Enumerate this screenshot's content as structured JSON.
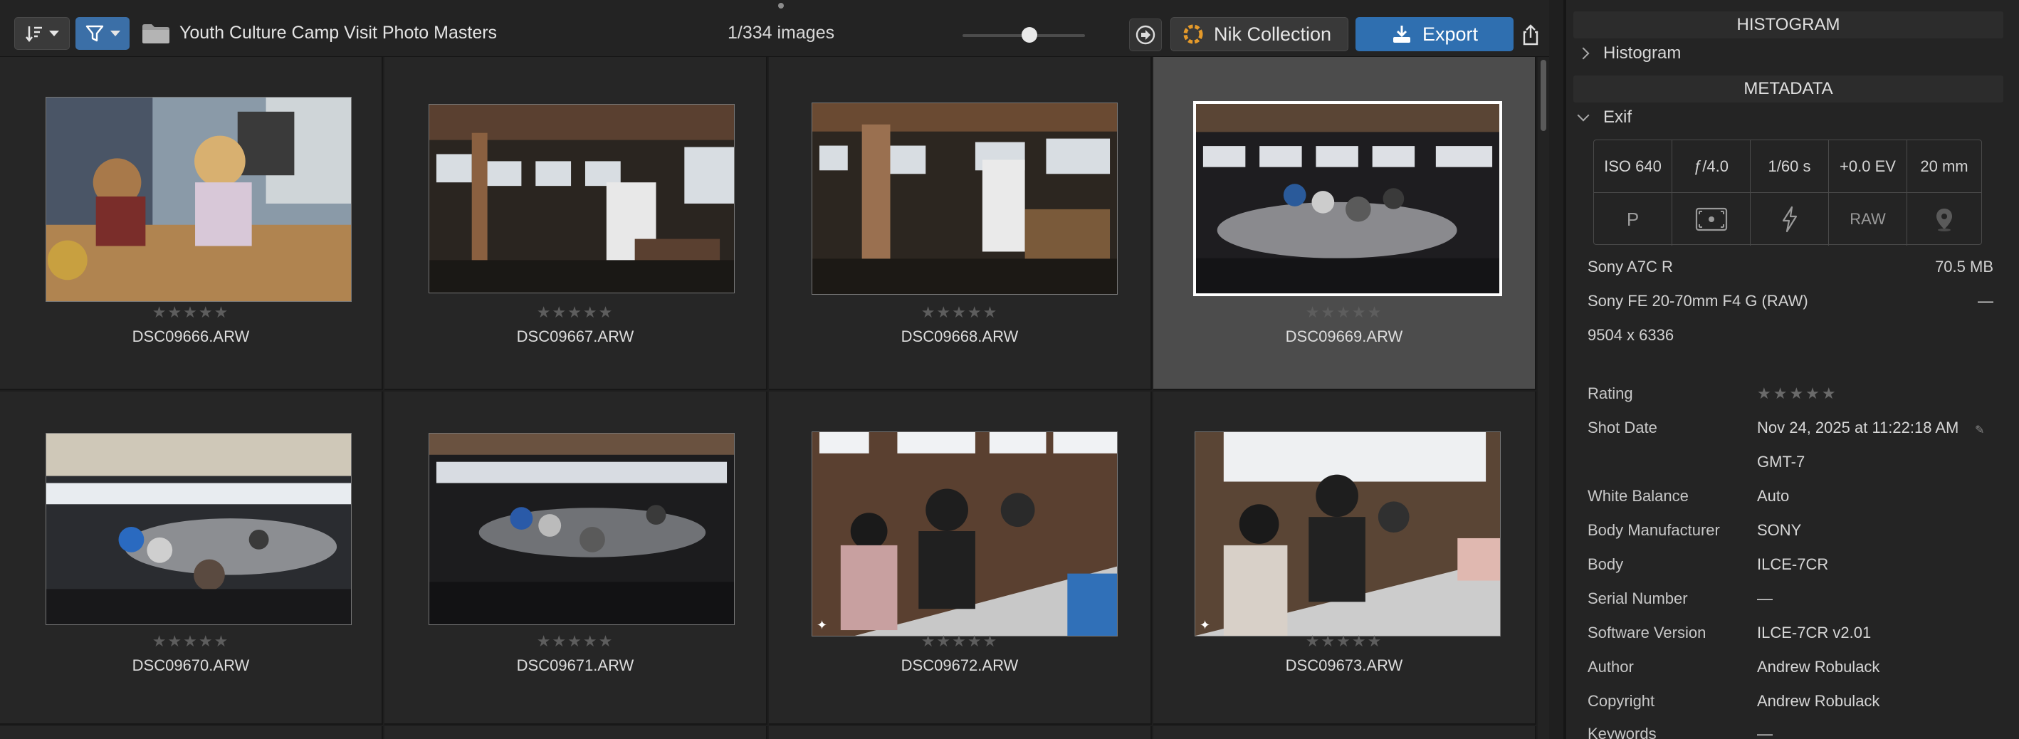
{
  "toolbar": {
    "folder_name": "Youth Culture Camp Visit Photo Masters",
    "image_count": "1/334 images",
    "nik_label": "Nik Collection",
    "export_label": "Export",
    "zoom_level": 0.55,
    "icons": [
      "sort-icon",
      "filter-icon",
      "folder-icon",
      "goto-icon",
      "nik-logo-icon",
      "export-icon",
      "share-icon"
    ]
  },
  "thumbnails": [
    {
      "filename": "DSC09666.ARW",
      "stars": "★★★★★",
      "rating": 0,
      "selected": false,
      "edited": false
    },
    {
      "filename": "DSC09667.ARW",
      "stars": "★★★★★",
      "rating": 0,
      "selected": false,
      "edited": false
    },
    {
      "filename": "DSC09668.ARW",
      "stars": "★★★★★",
      "rating": 0,
      "selected": false,
      "edited": false
    },
    {
      "filename": "DSC09669.ARW",
      "stars": "★★★★★",
      "rating": 0,
      "selected": true,
      "edited": false
    },
    {
      "filename": "DSC09670.ARW",
      "stars": "★★★★★",
      "rating": 0,
      "selected": false,
      "edited": false
    },
    {
      "filename": "DSC09671.ARW",
      "stars": "★★★★★",
      "rating": 0,
      "selected": false,
      "edited": false
    },
    {
      "filename": "DSC09672.ARW",
      "stars": "★★★★★",
      "rating": 0,
      "selected": false,
      "edited": true
    },
    {
      "filename": "DSC09673.ARW",
      "stars": "★★★★★",
      "rating": 0,
      "selected": false,
      "edited": true
    }
  ],
  "inspector": {
    "histogram_title": "HISTOGRAM",
    "histogram_section": "Histogram",
    "metadata_title": "METADATA",
    "exif_section": "Exif",
    "exif": {
      "iso": "ISO 640",
      "aperture": "ƒ/4.0",
      "shutter": "1/60 s",
      "ev": "+0.0 EV",
      "focal": "20 mm",
      "mode": "P",
      "raw": "RAW",
      "icons": [
        "metering-icon",
        "flash-icon",
        "location-icon"
      ]
    },
    "camera": "Sony A7C R",
    "file_size": "70.5 MB",
    "lens": "Sony FE 20-70mm F4 G (RAW)",
    "lens_extra": "—",
    "dimensions": "9504 x 6336",
    "fields": [
      {
        "key": "Rating",
        "value": "★★★★★"
      },
      {
        "key": "Shot Date",
        "value": "Nov 24, 2025 at 11:22:18 AM"
      },
      {
        "key": "",
        "value": "GMT-7"
      },
      {
        "key": "White Balance",
        "value": "Auto"
      },
      {
        "key": "Body Manufacturer",
        "value": "SONY"
      },
      {
        "key": "Body",
        "value": "ILCE-7CR"
      },
      {
        "key": "Serial Number",
        "value": "—"
      },
      {
        "key": "Software Version",
        "value": "ILCE-7CR v2.01"
      },
      {
        "key": "Author",
        "value": "Andrew Robulack"
      },
      {
        "key": "Copyright",
        "value": "Andrew Robulack"
      },
      {
        "key": "Keywords",
        "value": "—"
      }
    ]
  }
}
